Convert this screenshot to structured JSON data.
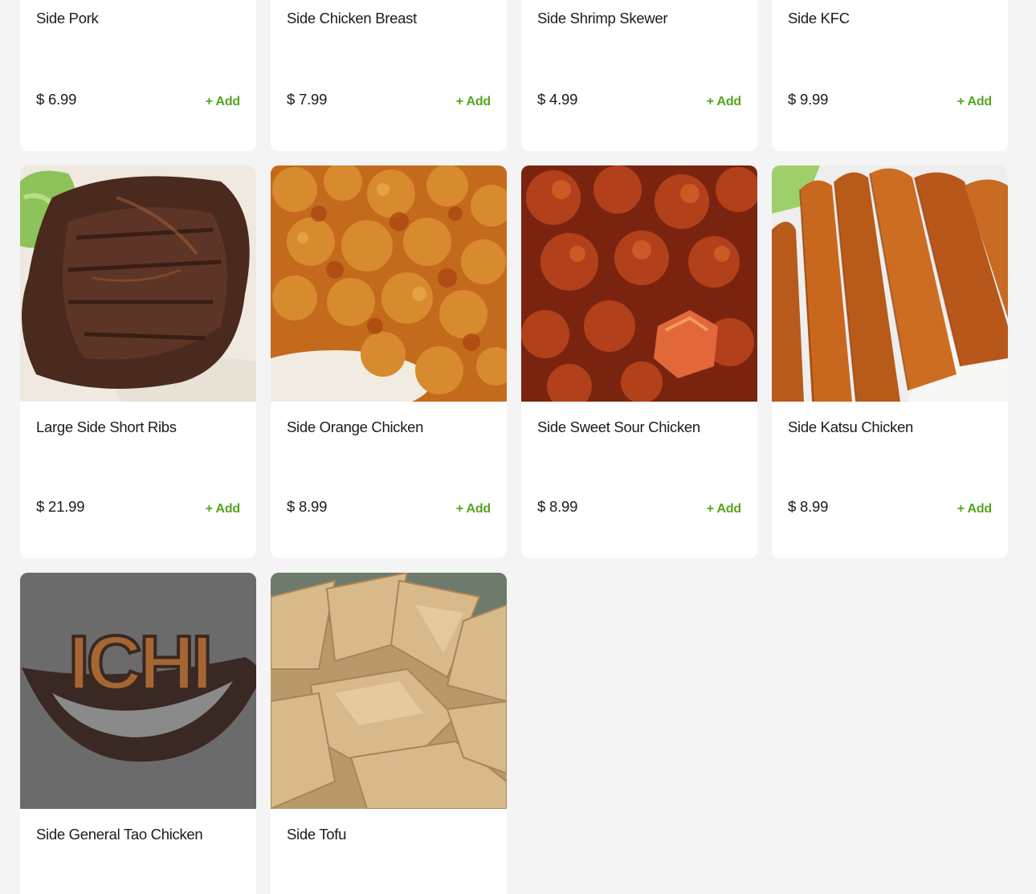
{
  "add_label": "+ Add",
  "colors": {
    "background": "#f4f4f4",
    "card": "#ffffff",
    "accent_green": "#55a51c",
    "text": "#1b1b1b"
  },
  "menu": {
    "items": [
      {
        "name": "Side Pork",
        "price": "$ 6.99"
      },
      {
        "name": "Side Chicken Breast",
        "price": "$ 7.99"
      },
      {
        "name": "Side Shrimp Skewer",
        "price": "$ 4.99"
      },
      {
        "name": "Side KFC",
        "price": "$ 9.99"
      },
      {
        "name": "Large Side Short Ribs",
        "price": "$ 21.99",
        "image": "short-ribs-photo"
      },
      {
        "name": "Side Orange Chicken",
        "price": "$ 8.99",
        "image": "orange-chicken-photo"
      },
      {
        "name": "Side Sweet Sour Chicken",
        "price": "$ 8.99",
        "image": "sweet-sour-chicken-photo"
      },
      {
        "name": "Side Katsu Chicken",
        "price": "$ 8.99",
        "image": "katsu-chicken-photo"
      },
      {
        "name": "Side General Tao Chicken",
        "image": "ichi-logo-placeholder",
        "logo_text": "ICHI"
      },
      {
        "name": "Side Tofu",
        "image": "fried-tofu-photo"
      }
    ]
  }
}
